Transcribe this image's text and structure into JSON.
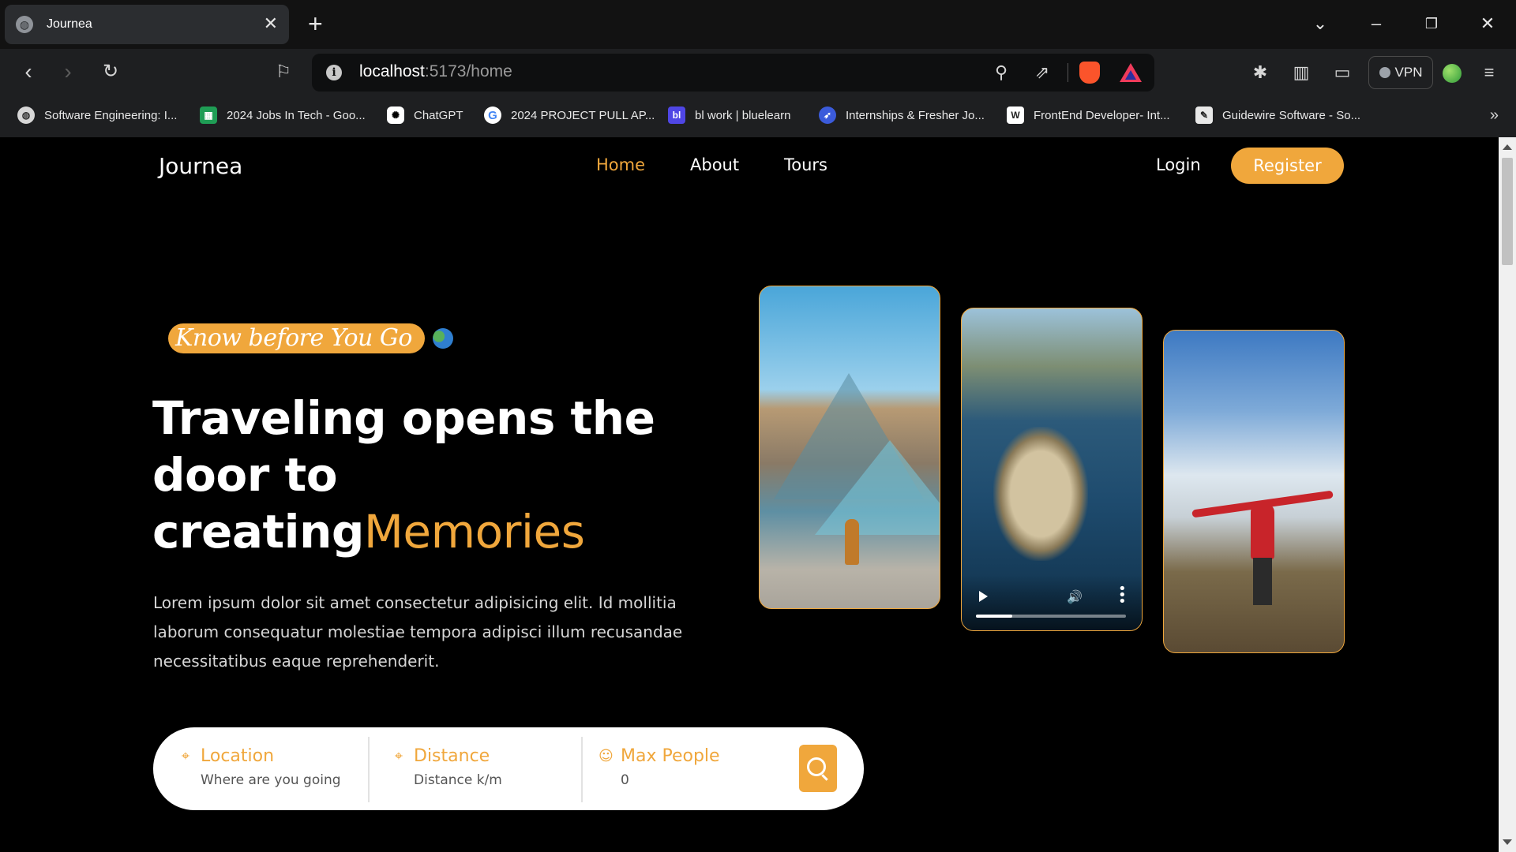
{
  "browser": {
    "tab_title": "Journea",
    "url_host": "localhost",
    "url_rest": ":5173/home",
    "vpn_label": "VPN",
    "bookmarks": [
      {
        "label": "Software Engineering: I...",
        "icon": "globe-icon"
      },
      {
        "label": "2024 Jobs In Tech - Goo...",
        "icon": "sheets-icon"
      },
      {
        "label": "ChatGPT",
        "icon": "chatgpt-icon"
      },
      {
        "label": "2024 PROJECT PULL AP...",
        "icon": "google-icon"
      },
      {
        "label": "bl work | bluelearn",
        "icon": "bluelearn-icon"
      },
      {
        "label": "Internships & Fresher Jo...",
        "icon": "rocket-icon"
      },
      {
        "label": "FrontEnd Developer- Int...",
        "icon": "w-icon"
      },
      {
        "label": "Guidewire Software - So...",
        "icon": "pen-icon"
      }
    ]
  },
  "site": {
    "logo": "Journea",
    "nav": [
      {
        "label": "Home",
        "active": true
      },
      {
        "label": "About",
        "active": false
      },
      {
        "label": "Tours",
        "active": false
      }
    ],
    "login_label": "Login",
    "register_label": "Register"
  },
  "hero": {
    "badge": "Know before You Go",
    "headline_main": "Traveling opens the door to creating",
    "headline_accent": "Memories",
    "description": "Lorem ipsum dolor sit amet consectetur adipisicing elit. Id mollitia laborum consequatur molestiae tempora adipisci illum recusandae necessitatibus eaque reprehenderit.",
    "video_progress": 0.24
  },
  "search": {
    "location_label": "Location",
    "location_placeholder": "Where are you going",
    "distance_label": "Distance",
    "distance_placeholder": "Distance k/m",
    "people_label": "Max People",
    "people_value": "0"
  },
  "colors": {
    "accent": "#f0a73c",
    "background": "#000000"
  }
}
